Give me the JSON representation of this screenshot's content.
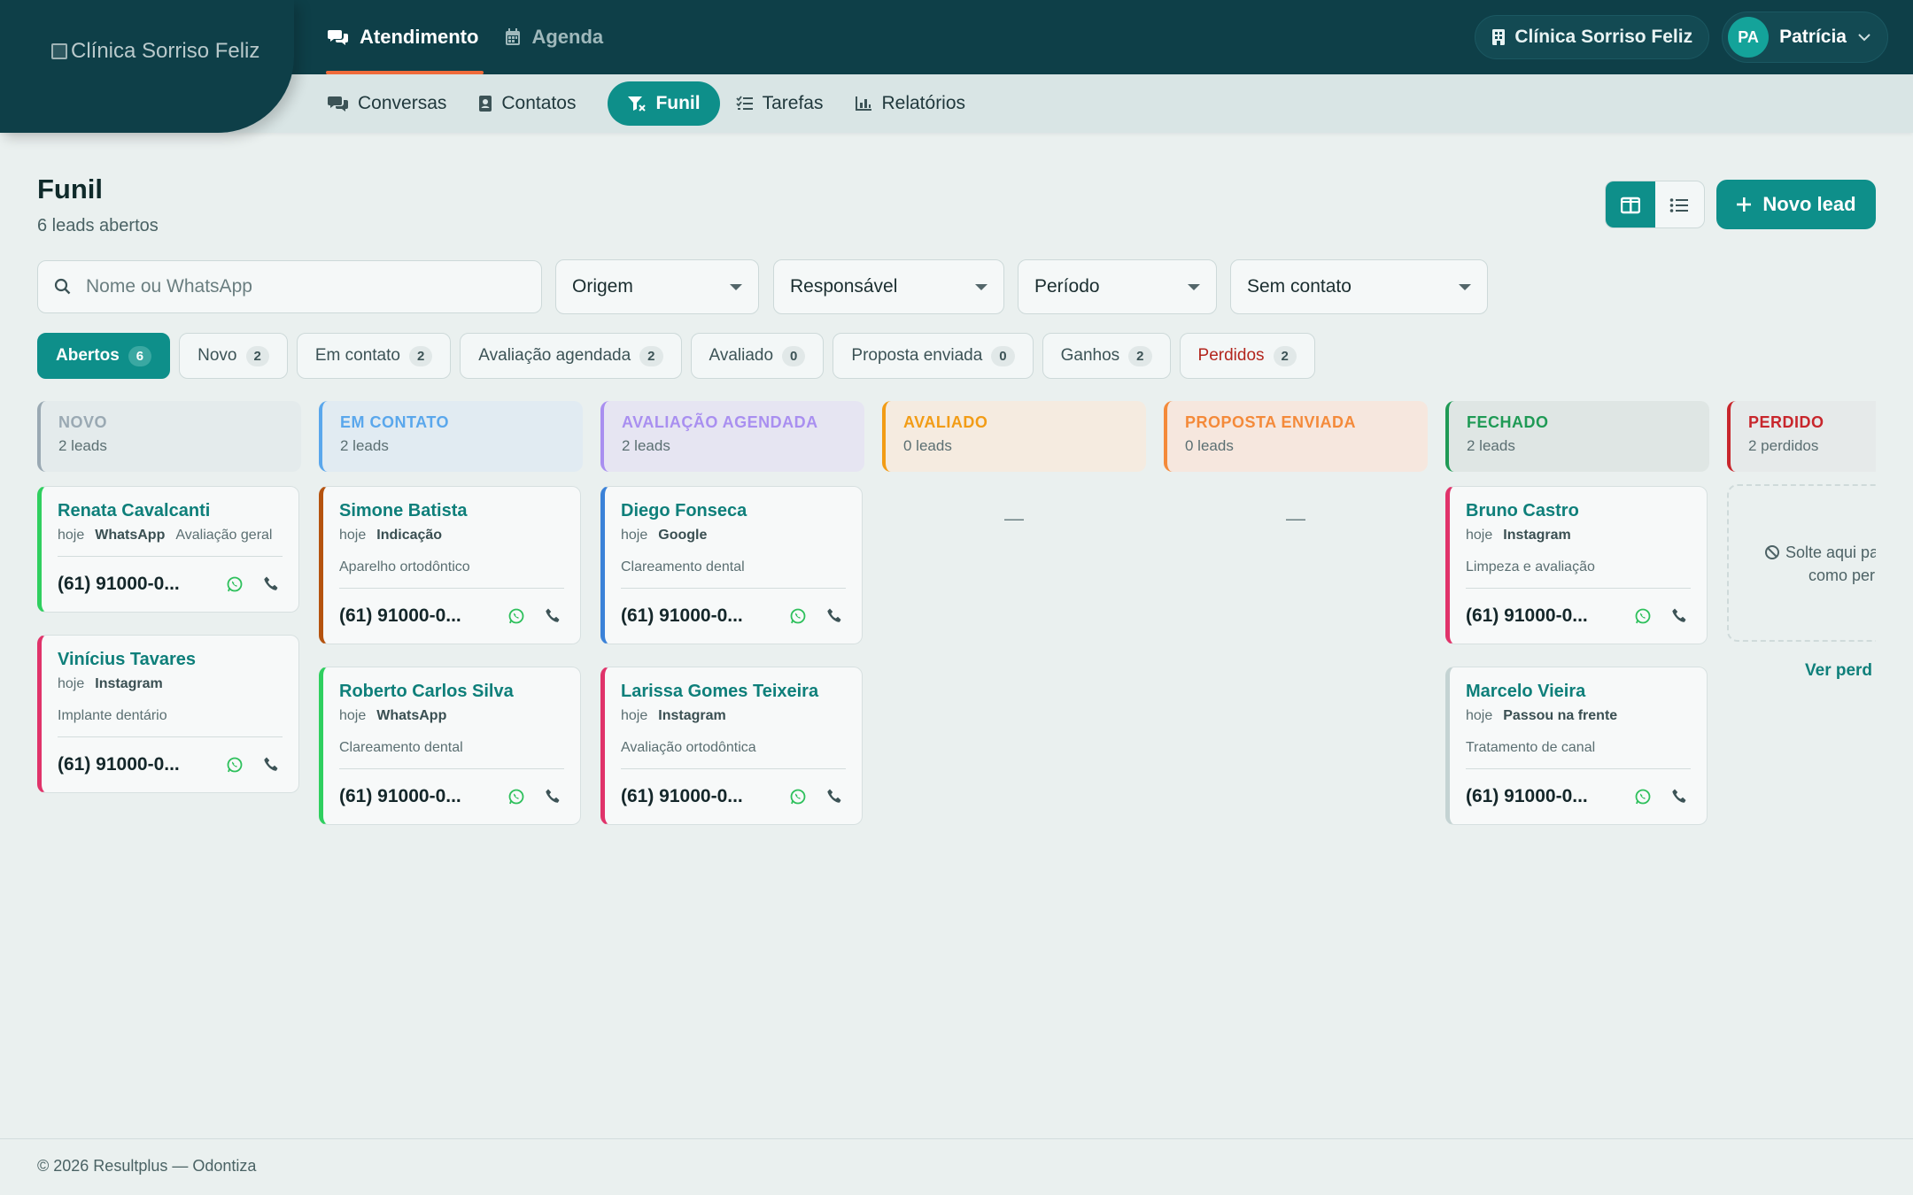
{
  "header": {
    "logo_alt": "Clínica Sorriso Feliz",
    "main_nav": [
      {
        "label": "Atendimento",
        "icon": "chat-bubbles-icon",
        "active": true
      },
      {
        "label": "Agenda",
        "icon": "calendar-icon",
        "active": false
      }
    ],
    "clinic": "Clínica Sorriso Feliz",
    "user_initials": "PA",
    "user_name": "Patrícia"
  },
  "subnav": [
    {
      "label": "Conversas",
      "icon": "chat-bubbles-icon"
    },
    {
      "label": "Contatos",
      "icon": "contact-book-icon"
    },
    {
      "label": "Funil",
      "icon": "funnel-icon",
      "active": true
    },
    {
      "label": "Tarefas",
      "icon": "task-list-icon"
    },
    {
      "label": "Relatórios",
      "icon": "bar-chart-icon"
    }
  ],
  "page": {
    "title": "Funil",
    "subtitle": "6 leads abertos",
    "new_lead_label": "Novo lead"
  },
  "filters": {
    "search_placeholder": "Nome ou WhatsApp",
    "origem": "Origem",
    "responsavel": "Responsável",
    "periodo": "Período",
    "sem_contato": "Sem contato"
  },
  "chips": [
    {
      "label": "Abertos",
      "count": "6"
    },
    {
      "label": "Novo",
      "count": "2"
    },
    {
      "label": "Em contato",
      "count": "2"
    },
    {
      "label": "Avaliação agendada",
      "count": "2"
    },
    {
      "label": "Avaliado",
      "count": "0"
    },
    {
      "label": "Proposta enviada",
      "count": "0"
    },
    {
      "label": "Ganhos",
      "count": "2"
    },
    {
      "label": "Perdidos",
      "count": "2"
    }
  ],
  "columns": [
    {
      "title": "NOVO",
      "count": "2 leads",
      "color": "#9aa9b3",
      "bg": "#e4ebec"
    },
    {
      "title": "EM CONTATO",
      "count": "2 leads",
      "color": "#5aa7ec",
      "bg": "#e1ebf2"
    },
    {
      "title": "AVALIAÇÃO AGENDADA",
      "count": "2 leads",
      "color": "#a98ff0",
      "bg": "#e6e5f2"
    },
    {
      "title": "AVALIADO",
      "count": "0 leads",
      "color": "#f29c16",
      "bg": "#f5ebe0",
      "empty": "—"
    },
    {
      "title": "PROPOSTA ENVIADA",
      "count": "0 leads",
      "color": "#f48a3a",
      "bg": "#f6e7de",
      "empty": "—"
    },
    {
      "title": "FECHADO",
      "count": "2 leads",
      "color": "#1f9a55",
      "bg": "#dfe6e4"
    },
    {
      "title": "PERDIDO",
      "count": "2 perdidos",
      "color": "#c8262c",
      "bg": "#e6eaea"
    }
  ],
  "cards": {
    "novo": [
      {
        "name": "Renata Cavalcanti",
        "when": "hoje",
        "source": "WhatsApp",
        "desc": "Avaliação geral",
        "phone": "(61) 91000-0...",
        "accent": "#2fcf5f"
      },
      {
        "name": "Vinícius Tavares",
        "when": "hoje",
        "source": "Instagram",
        "desc": "Implante dentário",
        "phone": "(61) 91000-0...",
        "accent": "#e0336a"
      }
    ],
    "em_contato": [
      {
        "name": "Simone Batista",
        "when": "hoje",
        "source": "Indicação",
        "desc": "Aparelho ortodôntico",
        "phone": "(61) 91000-0...",
        "accent": "#b5530f"
      },
      {
        "name": "Roberto Carlos Silva",
        "when": "hoje",
        "source": "WhatsApp",
        "desc": "Clareamento dental",
        "phone": "(61) 91000-0...",
        "accent": "#2fcf5f"
      }
    ],
    "avaliacao": [
      {
        "name": "Diego Fonseca",
        "when": "hoje",
        "source": "Google",
        "desc": "Clareamento dental",
        "phone": "(61) 91000-0...",
        "accent": "#3b82d8"
      },
      {
        "name": "Larissa Gomes Teixeira",
        "when": "hoje",
        "source": "Instagram",
        "desc": "Avaliação ortodôntica",
        "phone": "(61) 91000-0...",
        "accent": "#e0336a"
      }
    ],
    "fechado": [
      {
        "name": "Bruno Castro",
        "when": "hoje",
        "source": "Instagram",
        "desc": "Limpeza e avaliação",
        "phone": "(61) 91000-0...",
        "accent": "#e0336a"
      },
      {
        "name": "Marcelo Vieira",
        "when": "hoje",
        "source": "Passou na frente",
        "desc": "Tratamento de canal",
        "phone": "(61) 91000-0...",
        "accent": "#c4d3d3"
      }
    ]
  },
  "lost": {
    "drop_line1": "Solte aqui pa",
    "drop_line2": "como per",
    "see_link": "Ver perd"
  },
  "footer": "© 2026 Resultplus — Odontiza"
}
